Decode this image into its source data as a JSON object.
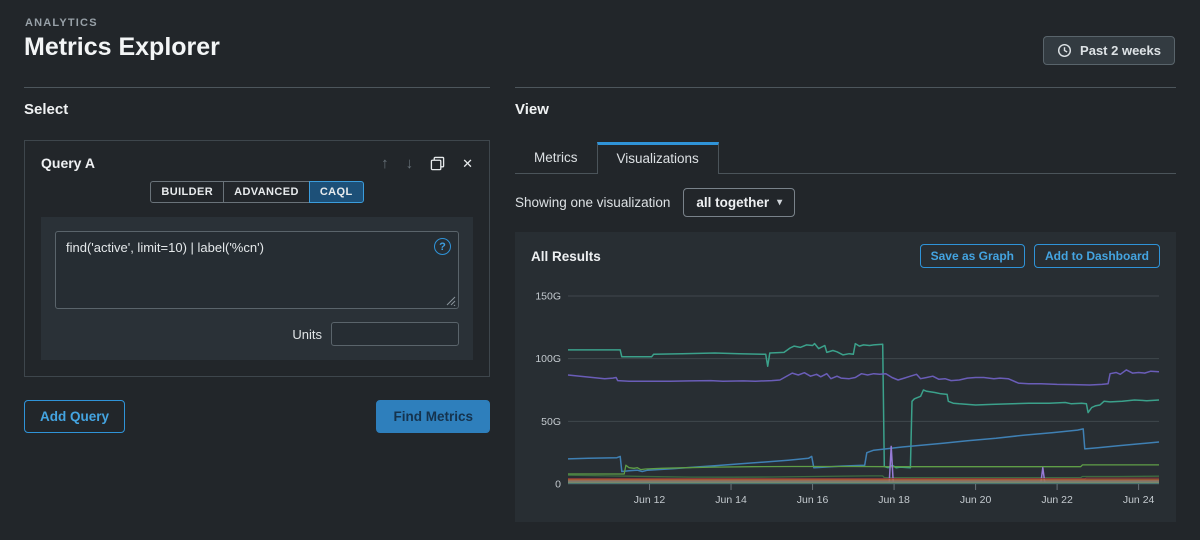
{
  "app": {
    "eyebrow": "ANALYTICS",
    "title": "Metrics Explorer",
    "time_range_label": "Past 2 weeks"
  },
  "icons": {
    "up_arrow": "↑",
    "down_arrow": "↓",
    "close": "✕",
    "help": "?",
    "caret_down": "▾"
  },
  "select_section": {
    "heading": "Select",
    "query_panel": {
      "title": "Query A",
      "modes": [
        {
          "label": "BUILDER",
          "active": false
        },
        {
          "label": "ADVANCED",
          "active": false
        },
        {
          "label": "CAQL",
          "active": true
        }
      ],
      "query_value": "find('active', limit=10) | label('%cn')",
      "units_label": "Units",
      "units_value": ""
    },
    "add_query_label": "Add Query",
    "find_metrics_label": "Find Metrics"
  },
  "view_section": {
    "heading": "View",
    "tabs": [
      {
        "label": "Metrics",
        "active": false
      },
      {
        "label": "Visualizations",
        "active": true
      }
    ],
    "showing_text": "Showing one visualization",
    "visualization_mode": "all together",
    "results_panel": {
      "title": "All Results",
      "save_as_graph_label": "Save as Graph",
      "add_to_dashboard_label": "Add to Dashboard"
    }
  },
  "colors": {
    "accent_blue": "#2f93d8",
    "page_bg": "#22262a",
    "panel_bg": "#282e33",
    "grid_line": "#3f474d",
    "tick_label": "#c4cacf"
  },
  "chart_data": {
    "type": "line",
    "title": "All Results",
    "xlabel": "",
    "ylabel": "",
    "x_range": [
      10,
      24.5
    ],
    "y_range": [
      0,
      150
    ],
    "grid": "horizontal",
    "legend": "none",
    "y_ticks": [
      {
        "v": 150,
        "label": "150G"
      },
      {
        "v": 100,
        "label": "100G"
      },
      {
        "v": 50,
        "label": "50G"
      },
      {
        "v": 0,
        "label": "0"
      }
    ],
    "x_ticks": [
      {
        "v": 12,
        "label": "Jun 12"
      },
      {
        "v": 14,
        "label": "Jun 14"
      },
      {
        "v": 16,
        "label": "Jun 16"
      },
      {
        "v": 18,
        "label": "Jun 18"
      },
      {
        "v": 20,
        "label": "Jun 20"
      },
      {
        "v": 22,
        "label": "Jun 22"
      },
      {
        "v": 24,
        "label": "Jun 24"
      }
    ],
    "series": [
      {
        "name": "teal-top",
        "color": "#3ba18b",
        "width": 1.5,
        "points": [
          [
            10,
            107
          ],
          [
            11.28,
            107
          ],
          [
            11.32,
            101.5
          ],
          [
            12.05,
            101.5
          ],
          [
            12.1,
            103.5
          ],
          [
            12.8,
            104
          ],
          [
            13.6,
            104.5
          ],
          [
            14.2,
            104
          ],
          [
            14.85,
            103.5
          ],
          [
            14.9,
            94
          ],
          [
            14.95,
            104.5
          ],
          [
            15.3,
            105
          ],
          [
            15.45,
            108.5
          ],
          [
            15.55,
            110
          ],
          [
            15.7,
            109
          ],
          [
            15.85,
            111
          ],
          [
            16.0,
            110.5
          ],
          [
            16.05,
            112
          ],
          [
            16.15,
            108
          ],
          [
            16.3,
            110.5
          ],
          [
            16.35,
            105
          ],
          [
            16.5,
            106.5
          ],
          [
            16.6,
            105.5
          ],
          [
            16.75,
            103
          ],
          [
            16.9,
            104
          ],
          [
            17.0,
            103.5
          ],
          [
            17.05,
            112
          ],
          [
            17.15,
            110
          ],
          [
            17.25,
            111
          ],
          [
            17.4,
            110.5
          ],
          [
            17.5,
            111
          ],
          [
            17.72,
            111.5
          ],
          [
            17.76,
            14
          ],
          [
            17.85,
            13
          ],
          [
            17.95,
            15
          ],
          [
            18.05,
            13
          ],
          [
            18.15,
            13.5
          ],
          [
            18.4,
            13
          ],
          [
            18.44,
            66
          ],
          [
            18.5,
            68
          ],
          [
            18.65,
            70
          ],
          [
            18.72,
            75
          ],
          [
            18.8,
            74
          ],
          [
            19.0,
            73
          ],
          [
            19.15,
            72
          ],
          [
            19.3,
            71.5
          ],
          [
            19.33,
            66
          ],
          [
            19.45,
            64.5
          ],
          [
            19.6,
            64
          ],
          [
            20.0,
            63
          ],
          [
            20.4,
            63.5
          ],
          [
            20.9,
            64
          ],
          [
            21.3,
            64.5
          ],
          [
            21.8,
            64.5
          ],
          [
            22.2,
            65
          ],
          [
            22.35,
            64
          ],
          [
            22.6,
            64.5
          ],
          [
            22.72,
            64
          ],
          [
            22.76,
            57
          ],
          [
            22.85,
            61
          ],
          [
            22.95,
            62.5
          ],
          [
            23.05,
            63
          ],
          [
            23.15,
            66
          ],
          [
            23.3,
            65.5
          ],
          [
            23.6,
            66
          ],
          [
            23.9,
            67
          ],
          [
            24.2,
            66.5
          ],
          [
            24.5,
            67
          ]
        ]
      },
      {
        "name": "purple",
        "color": "#6a5db8",
        "width": 1.5,
        "points": [
          [
            10,
            87
          ],
          [
            10.3,
            86
          ],
          [
            10.6,
            85
          ],
          [
            10.9,
            84
          ],
          [
            11.1,
            84.5
          ],
          [
            11.18,
            85
          ],
          [
            11.22,
            82.5
          ],
          [
            11.5,
            82
          ],
          [
            12,
            82
          ],
          [
            12.5,
            82
          ],
          [
            13,
            82.3
          ],
          [
            13.5,
            82.5
          ],
          [
            13.8,
            82
          ],
          [
            14.3,
            82.3
          ],
          [
            14.6,
            82
          ],
          [
            15,
            82.5
          ],
          [
            15.2,
            83
          ],
          [
            15.5,
            88.5
          ],
          [
            15.65,
            87
          ],
          [
            15.8,
            88.8
          ],
          [
            15.95,
            86
          ],
          [
            16.1,
            87.5
          ],
          [
            16.2,
            85.5
          ],
          [
            16.35,
            88
          ],
          [
            16.45,
            84
          ],
          [
            16.6,
            86
          ],
          [
            16.7,
            84.5
          ],
          [
            16.9,
            84
          ],
          [
            17.05,
            85
          ],
          [
            17.2,
            88
          ],
          [
            17.35,
            87
          ],
          [
            17.5,
            88
          ],
          [
            17.65,
            87.5
          ],
          [
            17.8,
            88
          ],
          [
            17.95,
            85
          ],
          [
            18.1,
            83
          ],
          [
            18.25,
            84.5
          ],
          [
            18.4,
            86
          ],
          [
            18.55,
            87.5
          ],
          [
            18.65,
            84
          ],
          [
            18.8,
            85
          ],
          [
            18.95,
            86
          ],
          [
            19.1,
            83.5
          ],
          [
            19.25,
            84
          ],
          [
            19.4,
            82.5
          ],
          [
            19.6,
            83
          ],
          [
            19.8,
            84.5
          ],
          [
            20.0,
            85
          ],
          [
            20.2,
            85
          ],
          [
            20.45,
            84
          ],
          [
            20.6,
            84.5
          ],
          [
            20.8,
            84
          ],
          [
            21.05,
            80.5
          ],
          [
            21.3,
            80
          ],
          [
            21.6,
            80
          ],
          [
            22.0,
            79.5
          ],
          [
            22.4,
            79.3
          ],
          [
            22.8,
            79
          ],
          [
            23.1,
            79.5
          ],
          [
            23.25,
            80
          ],
          [
            23.3,
            88
          ],
          [
            23.45,
            89
          ],
          [
            23.55,
            87.5
          ],
          [
            23.7,
            91
          ],
          [
            23.85,
            88.5
          ],
          [
            24.0,
            89
          ],
          [
            24.15,
            88.5
          ],
          [
            24.3,
            90
          ],
          [
            24.5,
            89.5
          ]
        ]
      },
      {
        "name": "blue",
        "color": "#3f80b4",
        "width": 1.5,
        "points": [
          [
            10,
            20
          ],
          [
            10.5,
            20.5
          ],
          [
            11.2,
            21
          ],
          [
            11.28,
            22
          ],
          [
            11.32,
            10
          ],
          [
            11.5,
            10.5
          ],
          [
            11.7,
            11
          ],
          [
            11.82,
            10
          ],
          [
            11.95,
            11
          ],
          [
            12.2,
            11.5
          ],
          [
            12.6,
            12.3
          ],
          [
            13.1,
            13.5
          ],
          [
            13.6,
            14.5
          ],
          [
            14.2,
            16
          ],
          [
            14.8,
            17.5
          ],
          [
            15.4,
            19
          ],
          [
            15.9,
            20.5
          ],
          [
            15.98,
            22
          ],
          [
            16.03,
            13
          ],
          [
            16.3,
            13.5
          ],
          [
            16.7,
            14.3
          ],
          [
            17.1,
            14.8
          ],
          [
            17.28,
            15
          ],
          [
            17.33,
            25
          ],
          [
            17.5,
            27
          ],
          [
            17.8,
            28
          ],
          [
            18.2,
            29.5
          ],
          [
            18.7,
            31
          ],
          [
            19.2,
            32.5
          ],
          [
            19.8,
            34.5
          ],
          [
            20.5,
            36.5
          ],
          [
            21.2,
            39
          ],
          [
            21.9,
            41
          ],
          [
            22.5,
            43
          ],
          [
            22.64,
            44
          ],
          [
            22.68,
            28
          ],
          [
            23.0,
            29
          ],
          [
            23.5,
            30.5
          ],
          [
            24.0,
            32
          ],
          [
            24.5,
            33.5
          ]
        ]
      },
      {
        "name": "green",
        "color": "#5f9e47",
        "width": 1.3,
        "points": [
          [
            10,
            8
          ],
          [
            11.38,
            8
          ],
          [
            11.42,
            15
          ],
          [
            11.5,
            13
          ],
          [
            11.62,
            12.5
          ],
          [
            11.7,
            13
          ],
          [
            11.78,
            11.5
          ],
          [
            11.9,
            12
          ],
          [
            12.3,
            12.5
          ],
          [
            12.9,
            13
          ],
          [
            13.6,
            13.5
          ],
          [
            14.5,
            13.8
          ],
          [
            15.5,
            14
          ],
          [
            17,
            14
          ],
          [
            18,
            13.8
          ],
          [
            20,
            13.8
          ],
          [
            22,
            13.8
          ],
          [
            22.58,
            13.8
          ],
          [
            22.62,
            15.2
          ],
          [
            23.5,
            15.2
          ],
          [
            24.5,
            15.2
          ]
        ]
      },
      {
        "name": "dark-green",
        "color": "#3d6b40",
        "width": 1.3,
        "points": [
          [
            10,
            7
          ],
          [
            11,
            6.5
          ],
          [
            11.5,
            6.2
          ],
          [
            12.2,
            5.8
          ],
          [
            13,
            5.5
          ],
          [
            14,
            5.4
          ],
          [
            15,
            5.6
          ],
          [
            16,
            6
          ],
          [
            16.8,
            6.3
          ],
          [
            17.4,
            6.5
          ],
          [
            17.72,
            6.5
          ],
          [
            17.76,
            5
          ],
          [
            18.3,
            5
          ],
          [
            20,
            5
          ],
          [
            22,
            5
          ],
          [
            22.58,
            5
          ],
          [
            22.62,
            6
          ],
          [
            23.5,
            6
          ],
          [
            24.5,
            6.2
          ]
        ]
      },
      {
        "name": "violet-spike-1",
        "color": "#977bd6",
        "width": 1.5,
        "points": [
          [
            17.88,
            0.5
          ],
          [
            17.93,
            30
          ],
          [
            17.98,
            0.5
          ]
        ]
      },
      {
        "name": "violet-spike-2",
        "color": "#977bd6",
        "width": 1.5,
        "points": [
          [
            21.6,
            0.5
          ],
          [
            21.65,
            13
          ],
          [
            21.7,
            0.5
          ]
        ]
      },
      {
        "name": "maroon-flat",
        "color": "#8e3b3b",
        "width": 1.2,
        "points": [
          [
            10,
            4.2
          ],
          [
            22.68,
            4.2
          ],
          [
            22.72,
            4.6
          ],
          [
            24.5,
            4.6
          ]
        ]
      },
      {
        "name": "orange-flat",
        "color": "#cd6f33",
        "width": 1.2,
        "points": [
          [
            10,
            3.2
          ],
          [
            24.5,
            3.2
          ]
        ]
      },
      {
        "name": "slate-flat",
        "color": "#5f7d94",
        "width": 1.2,
        "points": [
          [
            10,
            2.2
          ],
          [
            24.5,
            2.2
          ]
        ]
      },
      {
        "name": "amber-flat",
        "color": "#c07c3e",
        "width": 1.2,
        "points": [
          [
            10,
            1.4
          ],
          [
            24.5,
            1.4
          ]
        ]
      },
      {
        "name": "teal-flat",
        "color": "#4f8f85",
        "width": 1.2,
        "points": [
          [
            10,
            0.8
          ],
          [
            24.5,
            0.8
          ]
        ]
      }
    ]
  }
}
